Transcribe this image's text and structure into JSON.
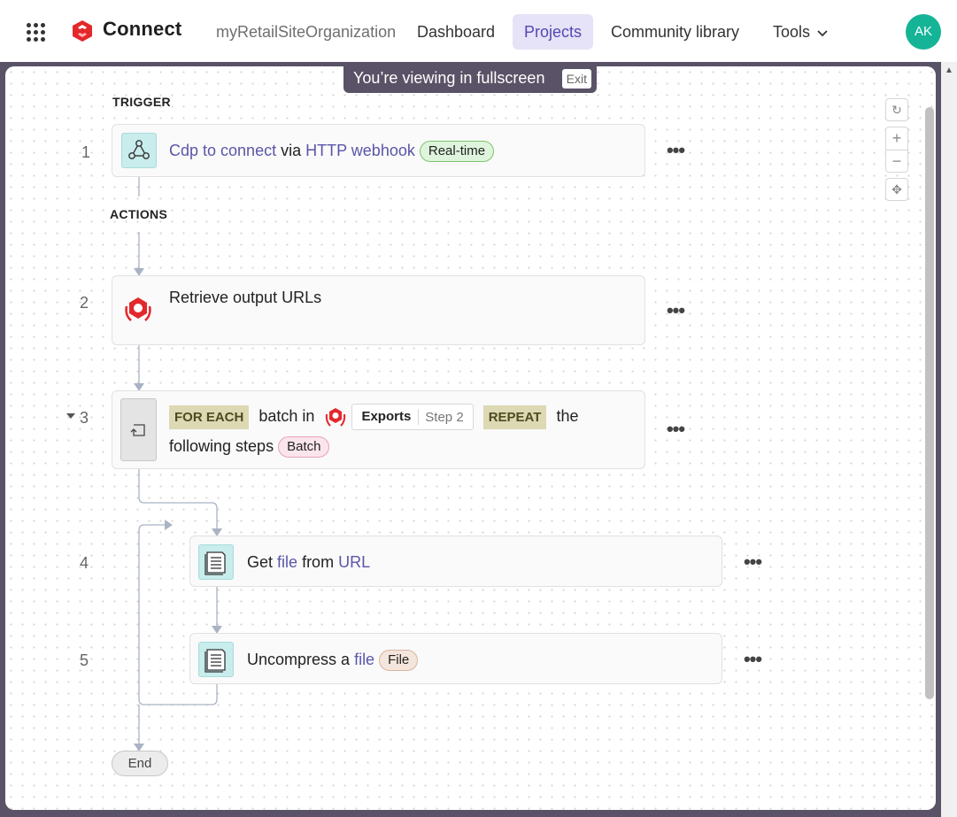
{
  "nav": {
    "brand": "Connect",
    "org": "myRetailSiteOrganization",
    "items": [
      "Dashboard",
      "Projects",
      "Community library",
      "Tools"
    ],
    "active": "Projects",
    "avatar": "AK",
    "accent": "#5248b3",
    "avatar_color": "#15b497"
  },
  "fullscreen": {
    "message": "You’re viewing in fullscreen",
    "exit": "Exit"
  },
  "flow": {
    "trigger_label": "TRIGGER",
    "actions_label": "ACTIONS",
    "steps": [
      {
        "num": "1",
        "icon": "webhook-icon",
        "app": "Cdp to connect",
        "via": "via",
        "trigger": "HTTP webhook",
        "badge": "Real-time"
      },
      {
        "num": "2",
        "icon": "app-logo-icon",
        "title": "Retrieve output URLs"
      },
      {
        "num": "3",
        "icon": "repeat-icon",
        "foreach": "FOR EACH",
        "batch_in": "batch in",
        "datapill": "Exports",
        "datapill_step": "Step 2",
        "repeat": "REPEAT",
        "the": "the",
        "following": "following steps",
        "badge": "Batch"
      },
      {
        "num": "4",
        "icon": "document-icon",
        "get": "Get",
        "file": "file",
        "from": "from",
        "url": "URL"
      },
      {
        "num": "5",
        "icon": "document-icon",
        "uncompress": "Uncompress a",
        "file": "file",
        "badge": "File"
      }
    ],
    "end": "End"
  }
}
